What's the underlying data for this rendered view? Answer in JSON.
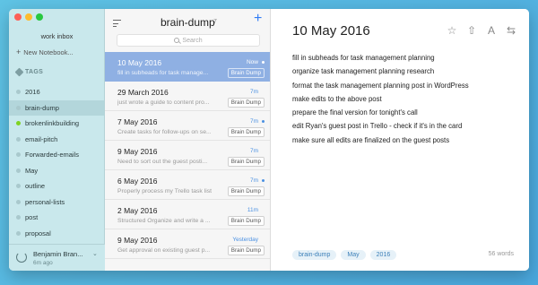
{
  "sidebar": {
    "inbox_label": "work inbox",
    "new_notebook_label": "New Notebook...",
    "tags_heading": "TAGS",
    "tags": [
      {
        "label": "2016",
        "selected": false,
        "dot": "default"
      },
      {
        "label": "brain-dump",
        "selected": true,
        "dot": "default"
      },
      {
        "label": "brokenlinkbuilding",
        "selected": false,
        "dot": "green"
      },
      {
        "label": "email-pitch",
        "selected": false,
        "dot": "default"
      },
      {
        "label": "Forwarded-emails",
        "selected": false,
        "dot": "default"
      },
      {
        "label": "May",
        "selected": false,
        "dot": "default"
      },
      {
        "label": "outline",
        "selected": false,
        "dot": "default"
      },
      {
        "label": "personal-lists",
        "selected": false,
        "dot": "default"
      },
      {
        "label": "post",
        "selected": false,
        "dot": "default"
      },
      {
        "label": "proposal",
        "selected": false,
        "dot": "default"
      }
    ],
    "user": {
      "name": "Benjamin Bran...",
      "last_sync": "6m ago"
    }
  },
  "list": {
    "title": "brain-dump",
    "count": "7",
    "search_placeholder": "Search",
    "notes": [
      {
        "date": "10 May 2016",
        "time": "Now",
        "preview": "fill in subheads for task manage...",
        "badge": "Brain Dump",
        "selected": true,
        "dot": true
      },
      {
        "date": "29 March 2016",
        "time": "7m",
        "preview": "just wrote a guide to content pro...",
        "badge": "Brain Dump",
        "selected": false,
        "dot": false
      },
      {
        "date": "7 May 2016",
        "time": "7m",
        "preview": "Create tasks for follow-ups on se...",
        "badge": "Brain Dump",
        "selected": false,
        "dot": true
      },
      {
        "date": "9 May 2016",
        "time": "7m",
        "preview": "Need to sort out the guest posti...",
        "badge": "Brain Dump",
        "selected": false,
        "dot": false
      },
      {
        "date": "6 May 2016",
        "time": "7m",
        "preview": "Properly process my Trello task list",
        "badge": "Brain Dump",
        "selected": false,
        "dot": true
      },
      {
        "date": "2 May 2016",
        "time": "11m",
        "preview": "Structured Organize and write a ...",
        "badge": "Brain Dump",
        "selected": false,
        "dot": false
      },
      {
        "date": "9 May 2016",
        "time": "Yesterday",
        "preview": "Get approval on existing guest p...",
        "badge": "Brain Dump",
        "selected": false,
        "dot": false
      }
    ]
  },
  "editor": {
    "title": "10 May 2016",
    "lines": [
      "fill in subheads for task management planning",
      "organize task management planning research",
      "format the task management planning post in WordPress",
      "make edits to the above post",
      "prepare the final version for tonight's call",
      "edit Ryan's guest post in Trello - check if it's in the card",
      "make sure all edits are finalized on the guest posts"
    ],
    "tags": [
      "brain-dump",
      "May",
      "2016"
    ],
    "word_count": "56 words",
    "icons": [
      "star-icon",
      "share-icon",
      "font-icon",
      "rotate-icon"
    ]
  },
  "colors": {
    "accent": "#2f7bf5",
    "selected_note": "#8fb0e3",
    "sidebar_bg": "#c9e8ec",
    "tag_bg": "#e6f1f8"
  }
}
